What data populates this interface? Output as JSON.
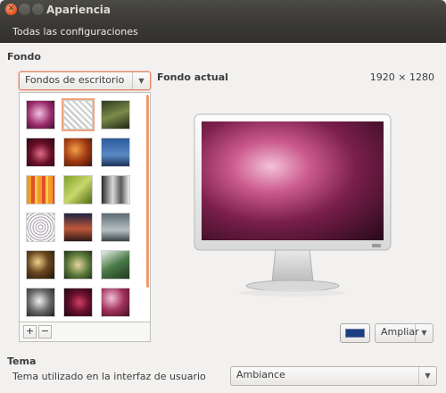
{
  "window": {
    "title": "Apariencia",
    "controls": [
      "close-icon",
      "minimize-icon",
      "maximize-icon"
    ]
  },
  "toolbar": {
    "all_settings_label": "Todas las configuraciones"
  },
  "background": {
    "section_label": "Fondo",
    "source_combo_value": "Fondos de escritorio",
    "current_label": "Fondo actual",
    "resolution": "1920 × 1280",
    "add_label": "+",
    "remove_label": "−",
    "color_value": "#1b3e82",
    "zoom_value": "Ampliar"
  },
  "theme": {
    "section_label": "Tema",
    "description": "Tema utilizado en la interfaz de usuario",
    "value": "Ambiance"
  },
  "colors": {
    "accent": "#dd4814",
    "titlebar": "#3c3b37"
  }
}
